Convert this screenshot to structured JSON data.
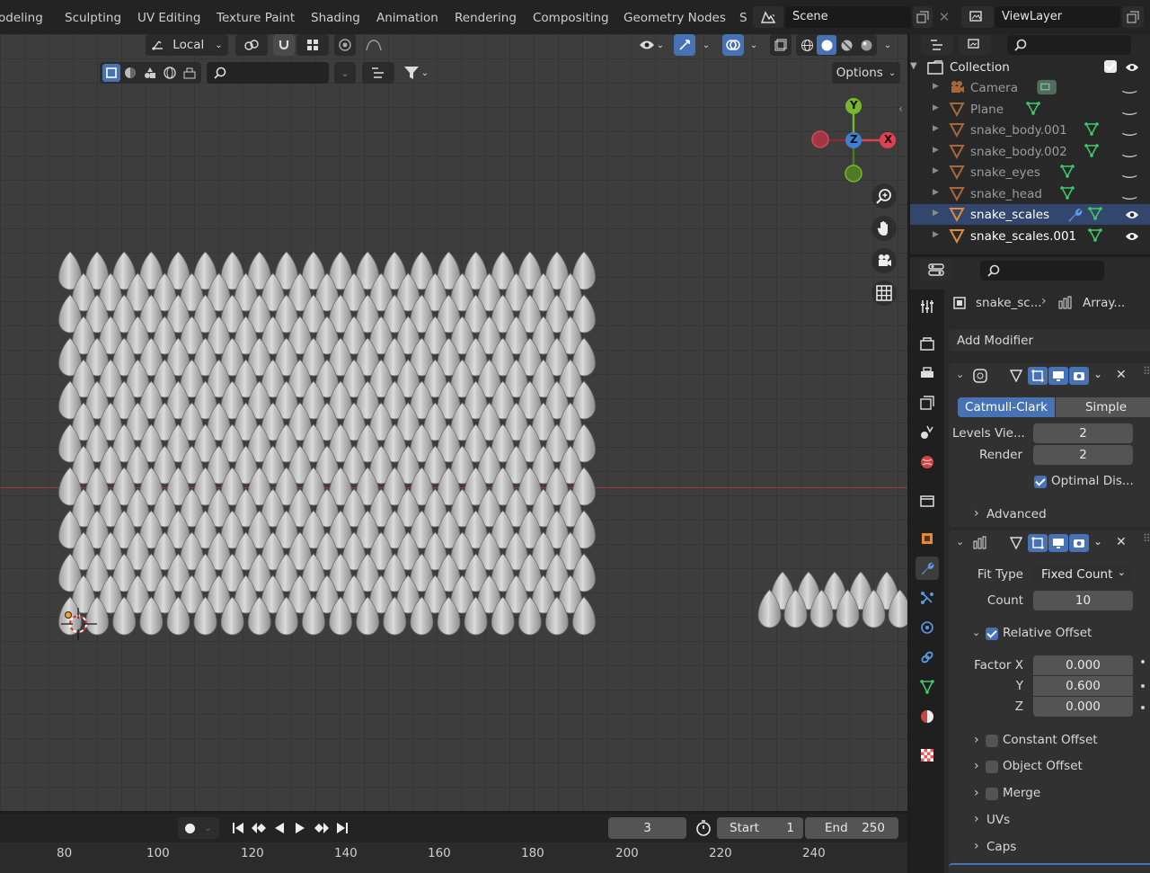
{
  "workspace_tabs": [
    "odeling",
    "Sculpting",
    "UV Editing",
    "Texture Paint",
    "Shading",
    "Animation",
    "Rendering",
    "Compositing",
    "Geometry Nodes",
    "S"
  ],
  "scene": {
    "name": "Scene",
    "view_layer": "ViewLayer"
  },
  "viewport": {
    "transform_orientation": "Local",
    "options_label": "Options",
    "gizmo": {
      "y": "Y",
      "x": "X",
      "z": "Z"
    },
    "scales_grid": {
      "rows": 17,
      "cols": 20
    },
    "scales_strip": {
      "rows": 2,
      "cols": 7
    }
  },
  "outliner": {
    "collection": "Collection",
    "items": [
      {
        "name": "Camera",
        "icon": "camera-icon",
        "state": "normal"
      },
      {
        "name": "Plane",
        "icon": "mesh-icon",
        "state": "normal"
      },
      {
        "name": "snake_body.001",
        "icon": "mesh-icon",
        "state": "normal"
      },
      {
        "name": "snake_body.002",
        "icon": "mesh-icon",
        "state": "normal"
      },
      {
        "name": "snake_eyes",
        "icon": "mesh-icon",
        "state": "normal"
      },
      {
        "name": "snake_head",
        "icon": "mesh-icon",
        "state": "normal"
      },
      {
        "name": "snake_scales",
        "icon": "mesh-icon",
        "state": "active"
      },
      {
        "name": "snake_scales.001",
        "icon": "mesh-icon",
        "state": "selected"
      }
    ]
  },
  "properties": {
    "breadcrumb_object": "snake_sc...",
    "breadcrumb_modifier": "Array...",
    "add_modifier": "Add Modifier",
    "subsurf": {
      "mode_catmull": "Catmull-Clark",
      "mode_simple": "Simple",
      "levels_label": "Levels Vie...",
      "levels_value": "2",
      "render_label": "Render",
      "render_value": "2",
      "optimal_label": "Optimal Dis...",
      "advanced_label": "Advanced"
    },
    "array": {
      "fit_type_label": "Fit Type",
      "fit_type_value": "Fixed Count",
      "count_label": "Count",
      "count_value": "10",
      "relative_offset_label": "Relative Offset",
      "factor_x_label": "Factor X",
      "factor_x_value": "0.000",
      "y_label": "Y",
      "y_value": "0.600",
      "z_label": "Z",
      "z_value": "0.000",
      "constant_offset_label": "Constant Offset",
      "object_offset_label": "Object Offset",
      "merge_label": "Merge",
      "uvs_label": "UVs",
      "caps_label": "Caps"
    }
  },
  "timeline": {
    "current_frame": "3",
    "start_label": "Start",
    "start_value": "1",
    "end_label": "End",
    "end_value": "250",
    "ruler_ticks": [
      "80",
      "100",
      "120",
      "140",
      "160",
      "180",
      "200",
      "220",
      "240"
    ]
  },
  "colors": {
    "accent": "#4772b3",
    "x_axis": "#e0414f",
    "y_axis": "#76b82a",
    "z_axis": "#3f7fd4",
    "mesh_icon": "#e08a3a"
  }
}
